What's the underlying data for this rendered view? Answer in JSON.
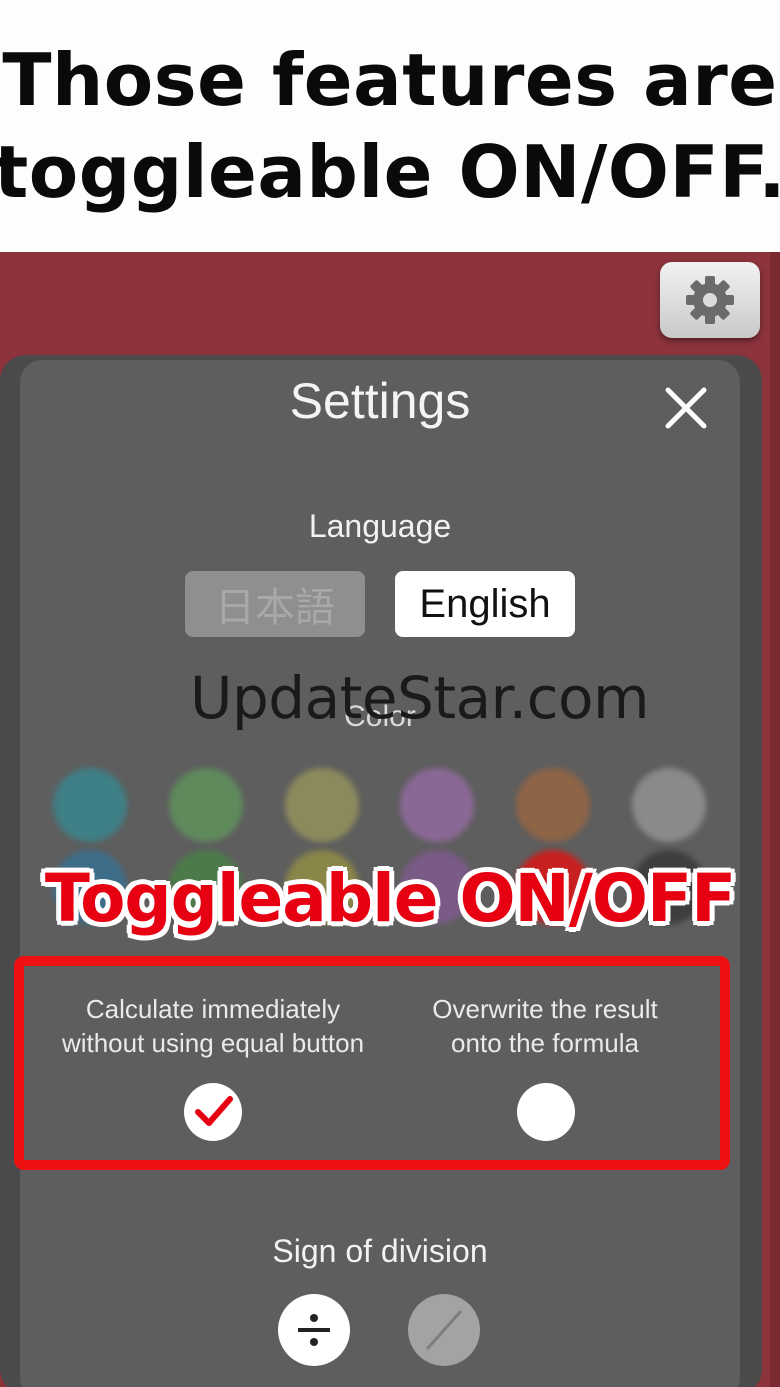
{
  "banner": {
    "line1": "Those features are",
    "line2": "toggleable ON/OFF."
  },
  "settings": {
    "title": "Settings",
    "language": {
      "label": "Language",
      "options": [
        "日本語",
        "English"
      ],
      "selected": "English"
    },
    "color": {
      "label": "Color",
      "row1": [
        "#3f7f86",
        "#5f8a5c",
        "#8c8a5c",
        "#8a6896",
        "#8e6447",
        "#8a8a8a"
      ]
    },
    "toggles": [
      {
        "label_line1": "Calculate immediately",
        "label_line2": "without using equal button",
        "checked": true
      },
      {
        "label_line1": "Overwrite the result",
        "label_line2": "onto the formula",
        "checked": false
      }
    ],
    "division": {
      "label": "Sign of division",
      "options": [
        "÷",
        "/"
      ],
      "selected": "÷"
    }
  },
  "watermark": "UpdateStar.com",
  "callout": "Toggleable ON/OFF",
  "colors": {
    "app_background": "#8c333c",
    "panel": "#5e5e5e",
    "highlight": "#ee1111",
    "check": "#e60012"
  }
}
